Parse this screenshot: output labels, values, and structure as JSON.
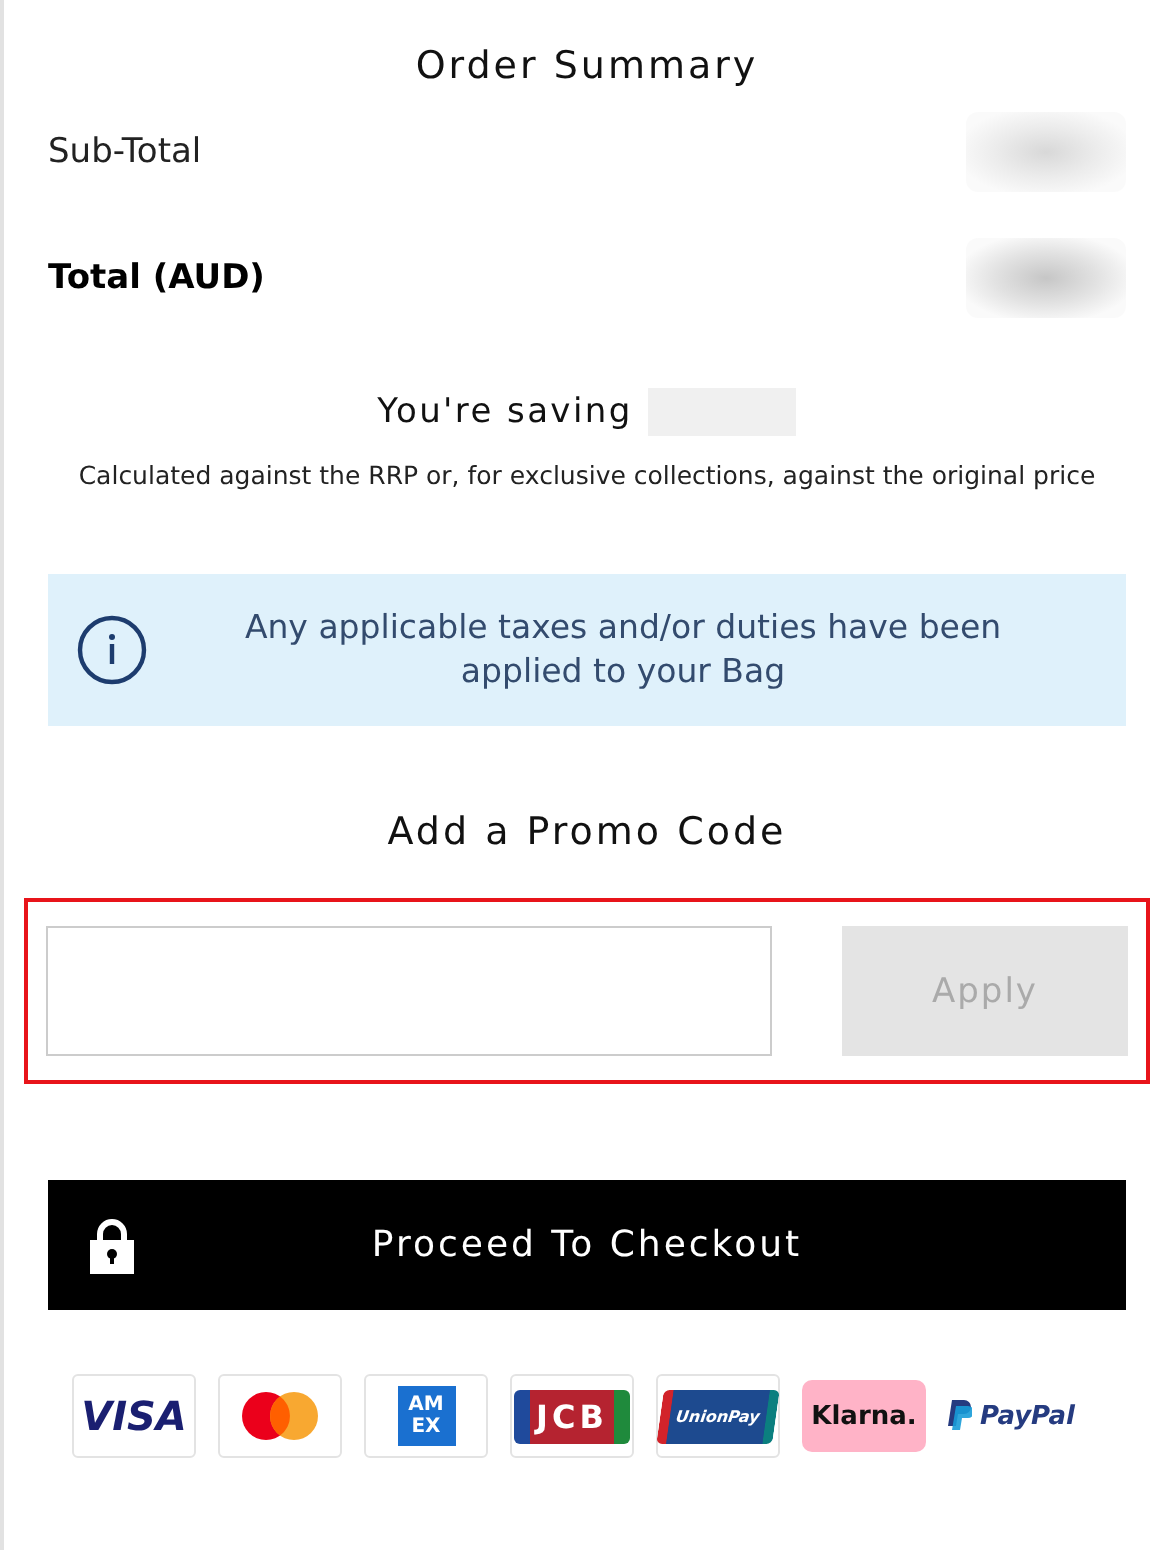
{
  "title": "Order Summary",
  "rows": [
    {
      "label": "Sub-Total",
      "bold": false
    },
    {
      "label": "Total (AUD)",
      "bold": true
    }
  ],
  "saving": {
    "label": "You're saving",
    "note": "Calculated against the RRP or, for exclusive collections, against the original price"
  },
  "info": {
    "text": "Any applicable taxes and/or duties have been applied to your Bag"
  },
  "promo": {
    "heading": "Add a Promo Code",
    "highlighted": true,
    "apply": {
      "label": "Apply",
      "disabled": true
    }
  },
  "checkout": {
    "label": "Proceed To Checkout"
  },
  "payments": [
    {
      "kind": "visa",
      "lines": [
        "VISA"
      ]
    },
    {
      "kind": "mastercard"
    },
    {
      "kind": "amex",
      "lines": [
        "AM",
        "EX"
      ]
    },
    {
      "kind": "jcb",
      "lines": [
        "JCB"
      ]
    },
    {
      "kind": "unionpay",
      "lines": [
        "UnionPay"
      ]
    },
    {
      "kind": "klarna",
      "lines": [
        "Klarna."
      ]
    },
    {
      "kind": "paypal",
      "lines": [
        "PayPal"
      ]
    }
  ]
}
